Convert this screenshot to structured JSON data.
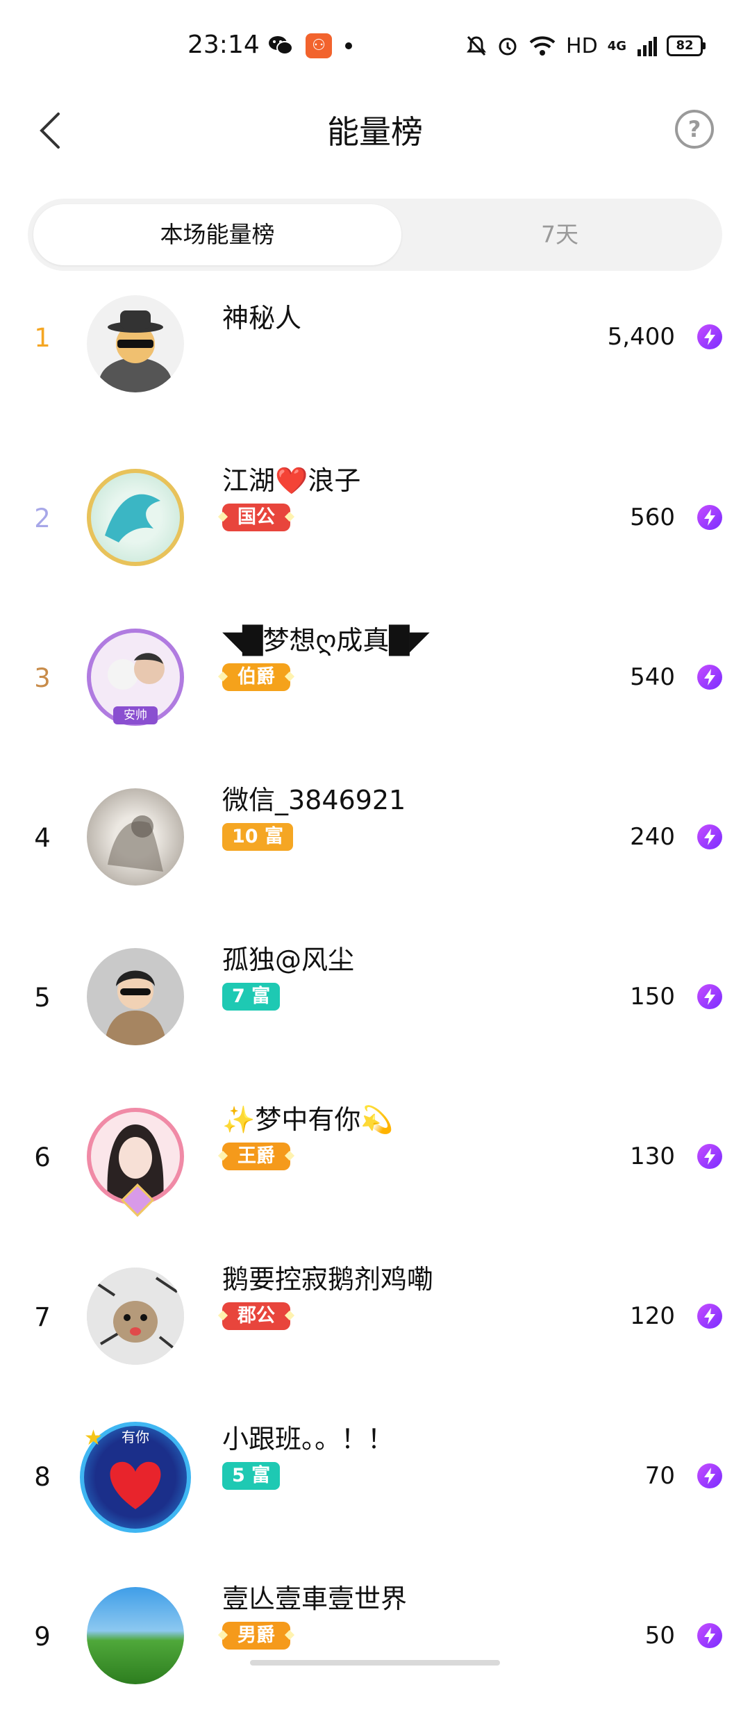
{
  "status_bar": {
    "time": "23:14",
    "network": "HD",
    "signal": "4G",
    "battery": "82",
    "icons": [
      "wechat-icon",
      "app-icon",
      "mute-icon",
      "alarm-icon",
      "wifi-icon",
      "signal-icon",
      "battery-icon"
    ]
  },
  "header": {
    "title": "能量榜",
    "back_icon": "chevron-left-icon",
    "help_icon": "help-icon",
    "help_label": "?"
  },
  "tabs": [
    {
      "label": "本场能量榜",
      "active": true
    },
    {
      "label": "7天",
      "active": false
    }
  ],
  "rows": [
    {
      "rank": "1",
      "rank_color": "#f5a623",
      "name": "神秘人",
      "badge": "",
      "badge_color": "",
      "score": "5,400",
      "avatar_icon": "mystery-person-avatar"
    },
    {
      "rank": "2",
      "rank_color": "#a7a7e8",
      "name": "江湖❤️浪子",
      "badge": "国公",
      "badge_color": "#e8453c",
      "score": "560",
      "avatar_icon": "dragon-avatar"
    },
    {
      "rank": "3",
      "rank_color": "#c88c4a",
      "name": "◥█梦想ღ成真█◤",
      "badge": "伯爵",
      "badge_color": "#f5a21b",
      "score": "540",
      "avatar_icon": "couple-avatar",
      "avatar_tag": "安帅"
    },
    {
      "rank": "4",
      "rank_color": "#111111",
      "name": "微信_3846921",
      "badge": "10 富",
      "badge_color": "#f5a623",
      "score": "240",
      "avatar_icon": "sketch-avatar"
    },
    {
      "rank": "5",
      "rank_color": "#111111",
      "name": "孤独@风尘",
      "badge": "7 富",
      "badge_color": "#1ec9b3",
      "score": "150",
      "avatar_icon": "cartoon-man-avatar"
    },
    {
      "rank": "6",
      "rank_color": "#111111",
      "name": "✨梦中有你💫",
      "badge": "王爵",
      "badge_color": "#f59a1b",
      "score": "130",
      "avatar_icon": "woman-avatar"
    },
    {
      "rank": "7",
      "rank_color": "#111111",
      "name": "鹅要控寂鹅剂鸡嘞",
      "badge": "郡公",
      "badge_color": "#e8453c",
      "score": "120",
      "avatar_icon": "cat-avatar"
    },
    {
      "rank": "8",
      "rank_color": "#111111",
      "name": "小跟班。。！！",
      "badge": "5 富",
      "badge_color": "#1ec9b3",
      "score": "70",
      "avatar_icon": "heart-avatar",
      "avatar_tag": "有你"
    },
    {
      "rank": "9",
      "rank_color": "#111111",
      "name": "壹亾壹車壹世界",
      "badge": "男爵",
      "badge_color": "#f59a1b",
      "score": "50",
      "avatar_icon": "grassland-avatar"
    }
  ],
  "score_icon": "lightning-icon"
}
